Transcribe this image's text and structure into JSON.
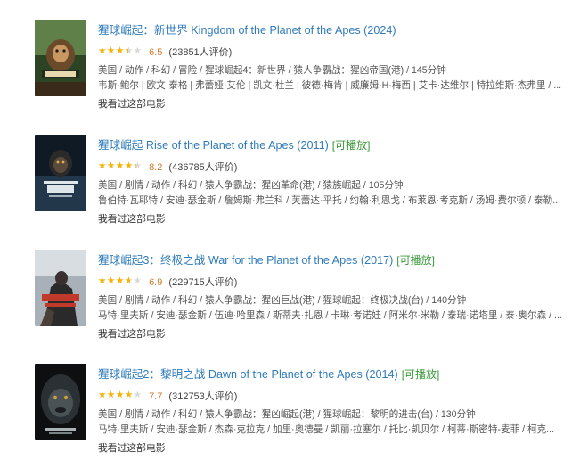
{
  "movies": [
    {
      "title": "猩球崛起：新世界 Kingdom of the Planet of the Apes (2024)",
      "playable": "",
      "stars_fraction": 0.65,
      "score": "6.5",
      "count": "(23851人评价)",
      "meta": "美国 / 动作 / 科幻 / 冒险 / 猩球崛起4：新世界 / 猿人争霸战：猩凶帝国(港) / 145分钟",
      "cast": "韦斯·鲍尔 | 欧文·泰格 | 弗蕾娅·艾伦 | 凯文·杜兰 | 彼德·梅肯 | 威廉姆·H·梅西 | 艾卡·达维尔 | 特拉维斯·杰弗里 / ...",
      "seen": "我看过这部电影",
      "poster_palette": [
        "#3c5a34",
        "#8a6a3a",
        "#d8b070"
      ],
      "poster_label": "猩球崛起"
    },
    {
      "title": "猩球崛起 Rise of the Planet of the Apes (2011)",
      "playable": "[可播放]",
      "stars_fraction": 0.82,
      "score": "8.2",
      "count": "(436785人评价)",
      "meta": "美国 / 剧情 / 动作 / 科幻 / 猿人争霸战：猩凶革命(港) / 猿族崛起 / 105分钟",
      "cast": "鲁伯特·瓦耶特 / 安迪·瑟金斯 / 詹姆斯·弗兰科 / 芙蕾达·平托 / 约翰·利思戈 / 布莱恩·考克斯 / 汤姆·费尔顿 / 泰勒...",
      "seen": "我看过这部电影",
      "poster_palette": [
        "#1e2c3a",
        "#4d6275",
        "#b8c4cc"
      ],
      "poster_label": "APES"
    },
    {
      "title": "猩球崛起3：终极之战 War for the Planet of the Apes (2017)",
      "playable": "[可播放]",
      "stars_fraction": 0.69,
      "score": "6.9",
      "count": "(229715人评价)",
      "meta": "美国 / 剧情 / 动作 / 科幻 / 猿人争霸战：猩凶巨战(港) / 猩球崛起：终极决战(台) / 140分钟",
      "cast": "马特·里夫斯 / 安迪·瑟金斯 / 伍迪·哈里森 / 斯蒂夫·扎恩 / 卡琳·考诺娃 / 阿米尔·米勒 / 泰瑞·诺塔里 / 泰·奥尔森 / ...",
      "seen": "我看过这部电影",
      "poster_palette": [
        "#6a7480",
        "#c0392b",
        "#e4e0d8"
      ],
      "poster_label": "猩球崛起"
    },
    {
      "title": "猩球崛起2：黎明之战 Dawn of the Planet of the Apes (2014)",
      "playable": "[可播放]",
      "stars_fraction": 0.77,
      "score": "7.7",
      "count": "(312753人评价)",
      "meta": "美国 / 剧情 / 动作 / 科幻 / 猿人争霸战：猩凶崛起(港) / 猩球崛起：黎明的进击(台) / 130分钟",
      "cast": "马特·里夫斯 / 安迪·瑟金斯 / 杰森·克拉克 / 加里·奥德曼 / 凯丽·拉塞尔 / 托比·凯贝尔 / 柯蒂·斯密特-麦菲 / 柯克...",
      "seen": "我看过这部电影",
      "poster_palette": [
        "#121517",
        "#2e3438",
        "#9aa1a6"
      ],
      "poster_label": "DAWN"
    }
  ]
}
